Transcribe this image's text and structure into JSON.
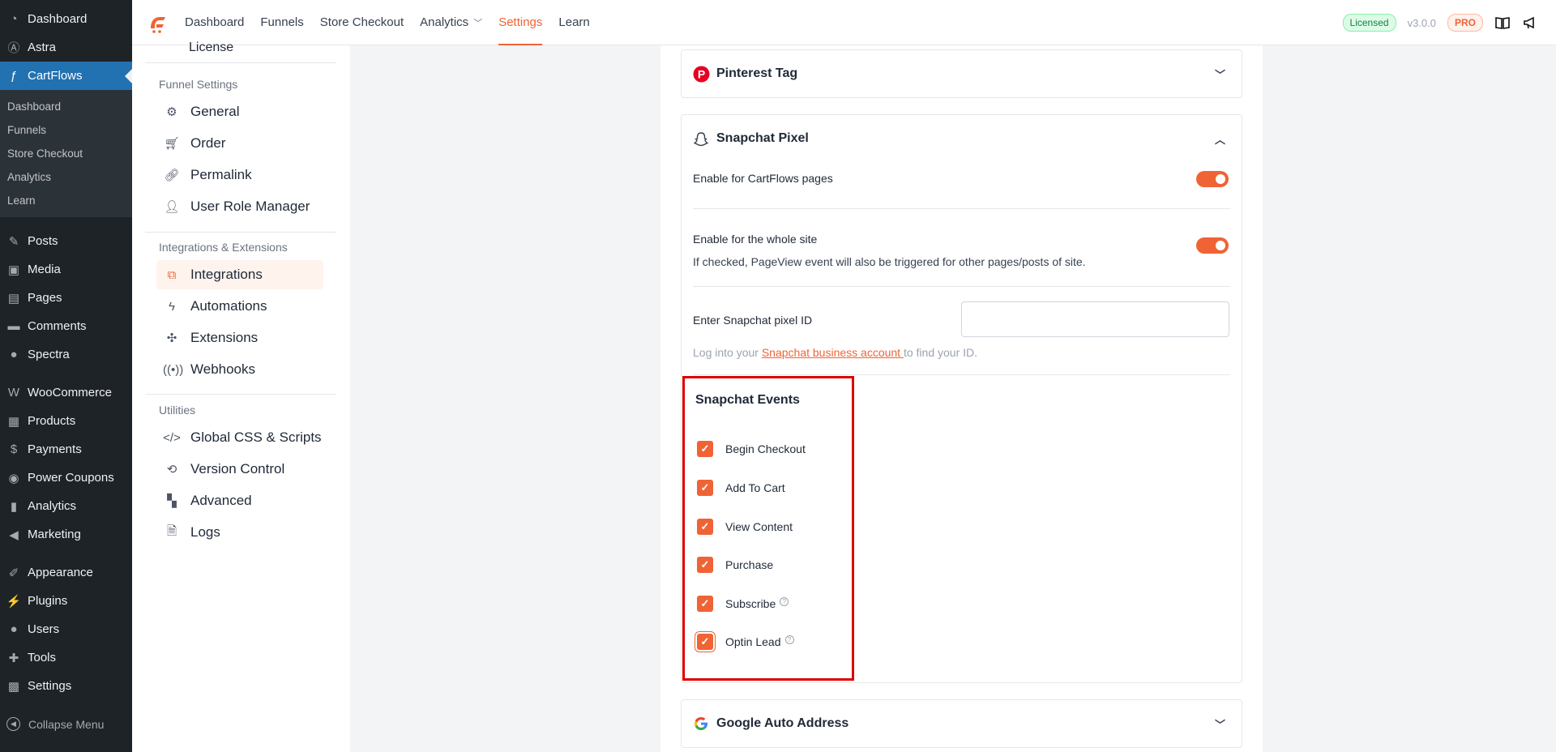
{
  "wp_menu": {
    "dashboard": "Dashboard",
    "astra": "Astra",
    "cartflows": "CartFlows",
    "cartflows_sub": [
      "Dashboard",
      "Funnels",
      "Store Checkout",
      "Analytics",
      "Learn"
    ],
    "posts": "Posts",
    "media": "Media",
    "pages": "Pages",
    "comments": "Comments",
    "spectra": "Spectra",
    "woocommerce": "WooCommerce",
    "products": "Products",
    "payments": "Payments",
    "power_coupons": "Power Coupons",
    "analytics": "Analytics",
    "marketing": "Marketing",
    "appearance": "Appearance",
    "plugins": "Plugins",
    "users": "Users",
    "tools": "Tools",
    "settings": "Settings",
    "collapse": "Collapse Menu"
  },
  "topnav": {
    "items": [
      "Dashboard",
      "Funnels",
      "Store Checkout",
      "Analytics",
      "Settings",
      "Learn"
    ],
    "licensed": "Licensed",
    "version": "v3.0.0",
    "pro": "PRO"
  },
  "settings_menu": {
    "cut_item": "License",
    "funnel_heading": "Funnel Settings",
    "general": "General",
    "order": "Order",
    "permalink": "Permalink",
    "user_role": "User Role Manager",
    "integrations_heading": "Integrations & Extensions",
    "integrations": "Integrations",
    "automations": "Automations",
    "extensions": "Extensions",
    "webhooks": "Webhooks",
    "utilities_heading": "Utilities",
    "global_css": "Global CSS & Scripts",
    "version_control": "Version Control",
    "advanced": "Advanced",
    "logs": "Logs"
  },
  "pinterest": {
    "title": "Pinterest Tag"
  },
  "snapchat": {
    "title": "Snapchat Pixel",
    "enable_pages": "Enable for CartFlows pages",
    "enable_site": "Enable for the whole site",
    "enable_site_help": "If checked, PageView event will also be triggered for other pages/posts of site.",
    "pixel_label": "Enter Snapchat pixel ID",
    "pixel_value": "",
    "login_prefix": "Log into your ",
    "login_link": "Snapchat business account ",
    "login_suffix": "to find your ID.",
    "events_title": "Snapchat Events",
    "events": [
      "Begin Checkout",
      "Add To Cart",
      "View Content",
      "Purchase",
      "Subscribe",
      "Optin Lead"
    ]
  },
  "google": {
    "title": "Google Auto Address"
  },
  "colors": {
    "accent": "#f06335",
    "wp_sidebar": "#1d2327",
    "wp_active": "#2271b1",
    "highlight_box": "#dc0000"
  }
}
